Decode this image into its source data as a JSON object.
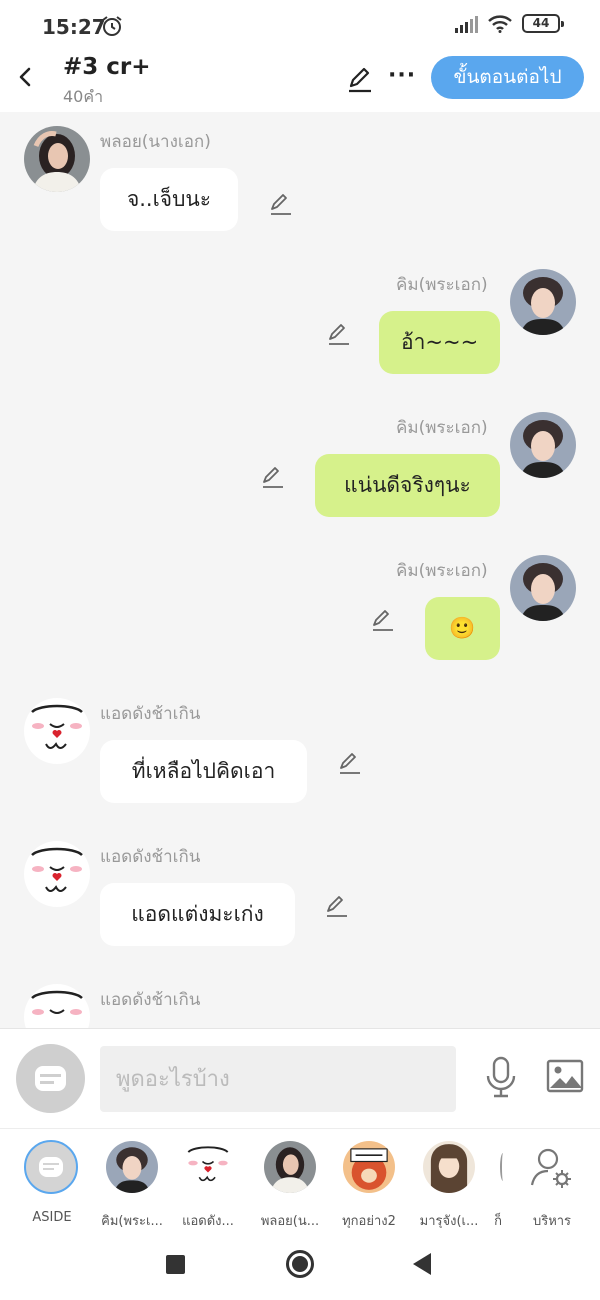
{
  "status": {
    "time": "15:27",
    "battery": "44"
  },
  "header": {
    "title": "#3 cr+",
    "word_count": "40คำ",
    "next_label": "ขั้นตอนต่อไป"
  },
  "messages": [
    {
      "side": "left",
      "sender": "พลอย(นางเอก)",
      "text": "จ..เจ็บนะ",
      "avatar": "woman-portrait"
    },
    {
      "side": "right",
      "sender": "คิม(พระเอก)",
      "text": "อ้า~~~",
      "avatar": "man-portrait"
    },
    {
      "side": "right",
      "sender": "คิม(พระเอก)",
      "text": "แน่นดีจริงๆนะ",
      "avatar": "man-portrait"
    },
    {
      "side": "right",
      "sender": "คิม(พระเอก)",
      "text": "🙂",
      "avatar": "man-portrait"
    },
    {
      "side": "left",
      "sender": "แอดดังช้าเกิน",
      "text": "ที่เหลือไปคิดเอา",
      "avatar": "mascot"
    },
    {
      "side": "left",
      "sender": "แอดดังช้าเกิน",
      "text": "แอดแต่งมะเก่ง",
      "avatar": "mascot"
    },
    {
      "side": "left",
      "sender": "แอดดังช้าเกิน",
      "text": "",
      "avatar": "mascot"
    }
  ],
  "input": {
    "placeholder": "พูดอะไรบ้าง"
  },
  "characters": [
    {
      "label": "ASIDE",
      "avatar": "aside"
    },
    {
      "label": "คิม(พระเ...",
      "avatar": "man-portrait"
    },
    {
      "label": "แอดดัง...",
      "avatar": "mascot"
    },
    {
      "label": "พลอย(น...",
      "avatar": "woman-portrait"
    },
    {
      "label": "ทุกอย่าง2",
      "avatar": "cartoon-sign"
    },
    {
      "label": "มารุจัง(เ...",
      "avatar": "anime-girl"
    },
    {
      "label": "ก็",
      "avatar": "partial"
    },
    {
      "label": "บริหาร",
      "avatar": "manage-icon"
    }
  ],
  "colors": {
    "accent": "#5aa7ee",
    "right_bubble": "#d6f18b",
    "left_bubble": "#ffffff",
    "background": "#f5f5f5"
  }
}
